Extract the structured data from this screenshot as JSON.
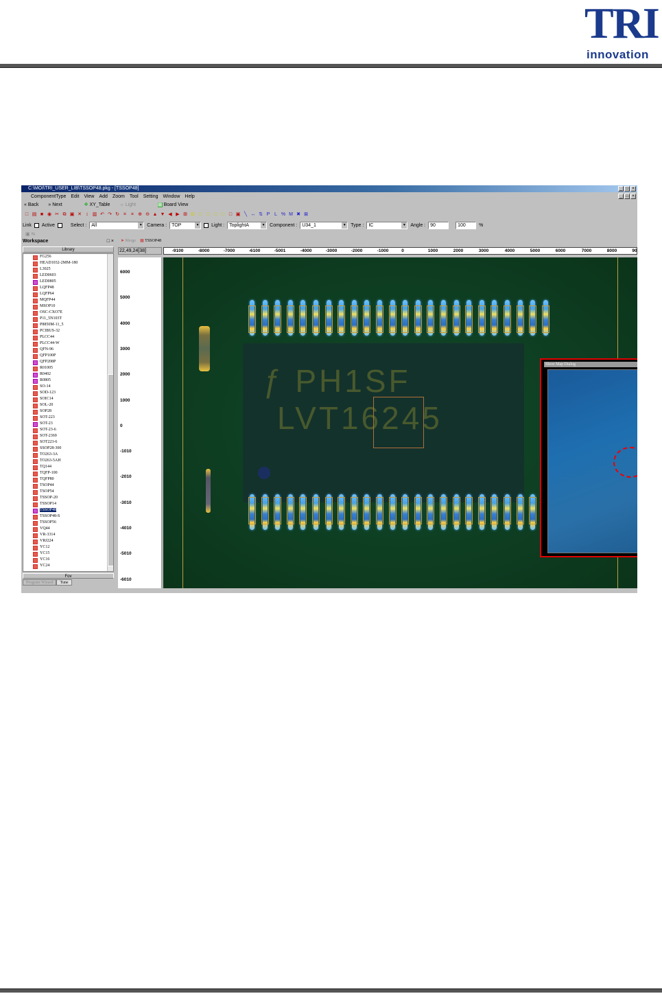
{
  "logo": {
    "brand": "TRI",
    "tagline": "innovation"
  },
  "window": {
    "title": "C:\\MOI\\TRI_USER_LIB\\TSSOP48.pkg - [TSSOP48]",
    "controls": [
      "_",
      "□",
      "×"
    ]
  },
  "menu": [
    "ComponentType",
    "Edit",
    "View",
    "Add",
    "Zoom",
    "Tool",
    "Setting",
    "Window",
    "Help"
  ],
  "nav": {
    "back": "Back",
    "next": "Next",
    "xy_table": "XY_Table",
    "light": "Light",
    "board_view": "Board View"
  },
  "toolbar_icons": [
    "new-icon",
    "open-icon",
    "save-icon",
    "refresh-icon",
    "cut-icon",
    "copy-icon",
    "paste-icon",
    "delete-icon",
    "move-icon",
    "layer-icon",
    "undo-icon",
    "redo-icon",
    "rotate-icon",
    "fit-icon",
    "fit2-icon",
    "zoom-in-icon",
    "zoom-out-icon",
    "up-icon",
    "down-icon",
    "left-icon",
    "right-icon",
    "grid-icon",
    "link-icon",
    "box1-icon",
    "box2-icon",
    "box3-icon",
    "box4-icon",
    "box5-icon",
    "measure-icon",
    "hdist-icon",
    "vdist-icon",
    "pl-icon",
    "percent-icon",
    "m-icon",
    "cross-icon",
    "expand-icon",
    "shrink-icon",
    "text-cursor-icon"
  ],
  "fields": {
    "link": "Link",
    "active": "Active",
    "select_label": "Select :",
    "select_value": "All",
    "camera_label": "Camera :",
    "camera_value": "TOP",
    "light_label": "Light :",
    "light_value": "ToplightA",
    "component_label": "Component :",
    "component_value": "U34_1",
    "type_label": "Type :",
    "type_value": "IC",
    "angle_label": "Angle :",
    "angle_value": "90",
    "scale_value": "100",
    "percent": "%"
  },
  "workspace": {
    "title": "Workspace",
    "library_header": "Library",
    "fov": "Fov",
    "bottom_tabs": [
      "Program Wizard",
      "Tune"
    ],
    "items": [
      {
        "label": "FG256",
        "pink": false
      },
      {
        "label": "HEAD1032-2MM-180",
        "pink": false
      },
      {
        "label": "L3025",
        "pink": false
      },
      {
        "label": "LED0603",
        "pink": false
      },
      {
        "label": "LED0805",
        "pink": true
      },
      {
        "label": "LQFP48",
        "pink": false
      },
      {
        "label": "LQFP64",
        "pink": false
      },
      {
        "label": "MQFP44",
        "pink": false
      },
      {
        "label": "MSOP10",
        "pink": false
      },
      {
        "label": "OSC-CXO7E",
        "pink": false
      },
      {
        "label": "P11_5N103T",
        "pink": false
      },
      {
        "label": "P8850M-11_5",
        "pink": false
      },
      {
        "label": "PCIBUS-32",
        "pink": false
      },
      {
        "label": "PLCC44",
        "pink": false
      },
      {
        "label": "PLCC44-W",
        "pink": false
      },
      {
        "label": "QFN-96",
        "pink": false
      },
      {
        "label": "QFP100P",
        "pink": false
      },
      {
        "label": "QFP208P",
        "pink": true
      },
      {
        "label": "R01005",
        "pink": false
      },
      {
        "label": "R0402",
        "pink": true
      },
      {
        "label": "R0805",
        "pink": true
      },
      {
        "label": "SO-14",
        "pink": false
      },
      {
        "label": "SOD-123",
        "pink": false
      },
      {
        "label": "SOIC14",
        "pink": false
      },
      {
        "label": "SOL-20",
        "pink": false
      },
      {
        "label": "SOP28",
        "pink": false
      },
      {
        "label": "SOT-223",
        "pink": false
      },
      {
        "label": "SOT-23",
        "pink": true
      },
      {
        "label": "SOT-23-6",
        "pink": false
      },
      {
        "label": "SOT-2369",
        "pink": false
      },
      {
        "label": "SOT223-6",
        "pink": false
      },
      {
        "label": "SSOP28-300",
        "pink": false
      },
      {
        "label": "TO263-3A",
        "pink": false
      },
      {
        "label": "TO263-5AH",
        "pink": false
      },
      {
        "label": "TQ144",
        "pink": false
      },
      {
        "label": "TQFP-100",
        "pink": false
      },
      {
        "label": "TQFP80",
        "pink": false
      },
      {
        "label": "TSOP44",
        "pink": false
      },
      {
        "label": "TSOP54",
        "pink": false
      },
      {
        "label": "TSSOP-20",
        "pink": false
      },
      {
        "label": "TSSOP14",
        "pink": false
      },
      {
        "label": "TSSOP48",
        "pink": true,
        "selected": true
      },
      {
        "label": "TSSOP48-S",
        "pink": false
      },
      {
        "label": "TSSOP56",
        "pink": false
      },
      {
        "label": "VQ44",
        "pink": false
      },
      {
        "label": "VR-3314",
        "pink": false
      },
      {
        "label": "VRJ224",
        "pink": false
      },
      {
        "label": "YC12",
        "pink": false
      },
      {
        "label": "YC15",
        "pink": false
      },
      {
        "label": "YC16",
        "pink": false
      },
      {
        "label": "YC24",
        "pink": false
      }
    ]
  },
  "view": {
    "tabs": [
      "Merge",
      "TSSOP48"
    ],
    "coord": "22,49,24[38]",
    "h_ticks": [
      "-9100",
      "-8000",
      "-7000",
      "-6100",
      "-5001",
      "-4000",
      "-3000",
      "-2000",
      "-1000",
      "0",
      "1000",
      "2000",
      "3000",
      "4000",
      "5000",
      "6000",
      "7000",
      "8000",
      "90"
    ],
    "v_ticks": [
      "6000",
      "5000",
      "4000",
      "3000",
      "2000",
      "1000",
      "0",
      "-1010",
      "-2010",
      "-3010",
      "-4010",
      "-5010",
      "-6010"
    ],
    "chip_marking": [
      "PH1SF",
      "LVT16245"
    ],
    "pins_per_side": 24,
    "minimap_title": "Show Map Dialog"
  }
}
